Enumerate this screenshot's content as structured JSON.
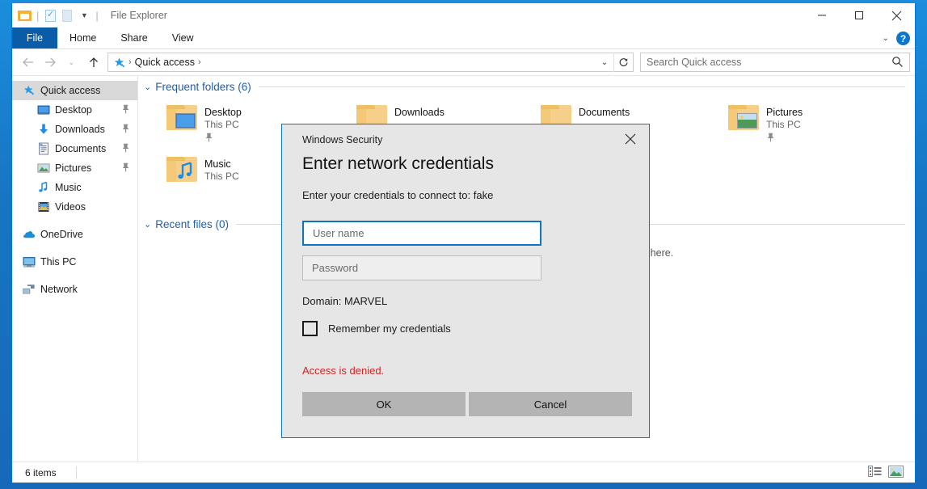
{
  "window": {
    "title": "File Explorer",
    "quick_access_toolbar": [
      {
        "name": "explorer-icon",
        "label": "File Explorer"
      },
      {
        "name": "properties-icon",
        "label": "Properties"
      },
      {
        "name": "new-folder-icon",
        "label": "New folder"
      },
      {
        "name": "customize-qat-icon",
        "label": "Customize Quick Access Toolbar"
      }
    ],
    "controls": {
      "minimize": "Minimize",
      "maximize": "Maximize",
      "close": "Close"
    }
  },
  "ribbon": {
    "tabs": [
      {
        "label": "File",
        "active": true
      },
      {
        "label": "Home",
        "active": false
      },
      {
        "label": "Share",
        "active": false
      },
      {
        "label": "View",
        "active": false
      }
    ],
    "expand_label": "Expand the Ribbon",
    "help_label": "?"
  },
  "address": {
    "back": "Back",
    "forward": "Forward",
    "recent": "Recent locations",
    "up": "Up",
    "crumb_root": "Quick access",
    "dropdown": "Previous locations",
    "refresh": "Refresh"
  },
  "search": {
    "placeholder": "Search Quick access"
  },
  "sidebar": {
    "items": [
      {
        "label": "Quick access",
        "icon": "star-pin-icon",
        "selected": true,
        "pinned": false,
        "indent": 0
      },
      {
        "label": "Desktop",
        "icon": "desktop-icon",
        "selected": false,
        "pinned": true,
        "indent": 1
      },
      {
        "label": "Downloads",
        "icon": "download-icon",
        "selected": false,
        "pinned": true,
        "indent": 1
      },
      {
        "label": "Documents",
        "icon": "document-icon",
        "selected": false,
        "pinned": true,
        "indent": 1
      },
      {
        "label": "Pictures",
        "icon": "pictures-icon",
        "selected": false,
        "pinned": true,
        "indent": 1
      },
      {
        "label": "Music",
        "icon": "music-icon",
        "selected": false,
        "pinned": false,
        "indent": 1
      },
      {
        "label": "Videos",
        "icon": "video-icon",
        "selected": false,
        "pinned": false,
        "indent": 1
      },
      {
        "label": "OneDrive",
        "icon": "cloud-icon",
        "selected": false,
        "pinned": false,
        "indent": 0
      },
      {
        "label": "This PC",
        "icon": "this-pc-icon",
        "selected": false,
        "pinned": false,
        "indent": 0
      },
      {
        "label": "Network",
        "icon": "network-icon",
        "selected": false,
        "pinned": false,
        "indent": 0
      }
    ]
  },
  "content": {
    "groups": [
      {
        "label": "Frequent folders (6)",
        "expanded": true
      },
      {
        "label": "Recent files (0)",
        "expanded": true
      }
    ],
    "frequent_folders": [
      {
        "name": "Desktop",
        "sub": "This PC",
        "pinned": true,
        "icon": "folder-desktop-icon"
      },
      {
        "name": "Downloads",
        "sub": "",
        "pinned": false,
        "icon": "folder-downloads-icon"
      },
      {
        "name": "Documents",
        "sub": "",
        "pinned": false,
        "icon": "folder-documents-icon"
      },
      {
        "name": "Pictures",
        "sub": "This PC",
        "pinned": true,
        "icon": "folder-pictures-icon"
      },
      {
        "name": "Music",
        "sub": "This PC",
        "pinned": false,
        "icon": "folder-music-icon"
      }
    ],
    "recent_files_empty": "es here."
  },
  "status": {
    "items": "6 items",
    "view_details": "Details view",
    "view_large_icons": "Large icons view"
  },
  "dialog": {
    "title": "Windows Security",
    "close": "Close",
    "heading": "Enter network credentials",
    "prompt": "Enter your credentials to connect to: fake",
    "username_placeholder": "User name",
    "password_placeholder": "Password",
    "domain": "Domain: MARVEL",
    "remember_label": "Remember my credentials",
    "error": "Access is denied.",
    "ok_label": "OK",
    "cancel_label": "Cancel"
  },
  "colors": {
    "accent": "#0078d7",
    "ribbon_file": "#0b5ca8",
    "error": "#d62020",
    "dialog_bg": "#e6e6e6",
    "button_bg": "#b4b4b4",
    "group_header": "#1f5fa8"
  }
}
